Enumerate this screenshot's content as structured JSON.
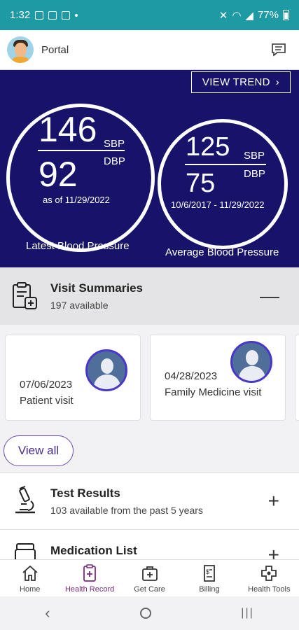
{
  "status_bar": {
    "time": "1:32",
    "battery_percent": "77%"
  },
  "header": {
    "title": "Portal"
  },
  "blood_pressure": {
    "view_trend_label": "VIEW TREND",
    "latest": {
      "sbp": "146",
      "dbp": "92",
      "sbp_label": "SBP",
      "dbp_label": "DBP",
      "as_of": "as of 11/29/2022",
      "caption": "Latest Blood Pressure"
    },
    "average": {
      "sbp": "125",
      "dbp": "75",
      "sbp_label": "SBP",
      "dbp_label": "DBP",
      "range": "10/6/2017 - 11/29/2022",
      "caption": "Average Blood Pressure"
    }
  },
  "visit_summaries": {
    "title": "Visit Summaries",
    "subtitle": "197 available",
    "toggle": "—",
    "cards": [
      {
        "date": "07/06/2023",
        "type": "Patient visit"
      },
      {
        "date": "04/28/2023",
        "type": "Family Medicine visit"
      }
    ],
    "view_all_label": "View all"
  },
  "test_results": {
    "title": "Test Results",
    "subtitle": "103 available from the past 5 years",
    "toggle": "+"
  },
  "medication_list": {
    "title": "Medication List",
    "toggle": "+"
  },
  "bottom_nav": [
    {
      "label": "Home",
      "icon": "home-icon"
    },
    {
      "label": "Health Record",
      "icon": "health-record-icon"
    },
    {
      "label": "Get Care",
      "icon": "medical-kit-icon"
    },
    {
      "label": "Billing",
      "icon": "billing-icon"
    },
    {
      "label": "Health Tools",
      "icon": "health-tools-icon"
    }
  ],
  "colors": {
    "status_bar": "#1e9aa5",
    "bp_band": "#17136b",
    "active_nav": "#7a2a7a",
    "view_all_border": "#6f4bb3"
  }
}
